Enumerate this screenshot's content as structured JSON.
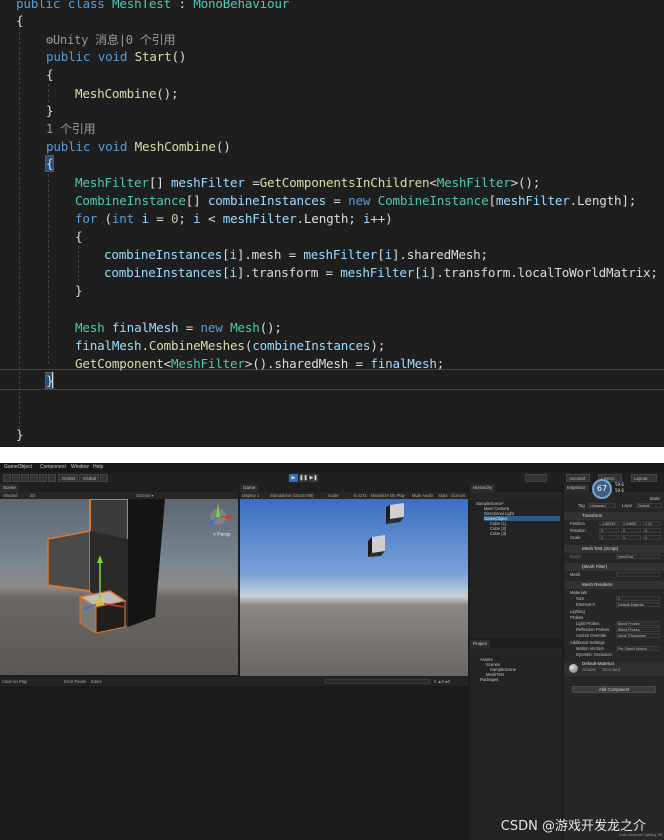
{
  "code_editor": {
    "lines": {
      "l0": {
        "kw1": "public",
        "kw2": "class",
        "name": "MeshTest",
        "colon": " : ",
        "base": "MonoBehaviour"
      },
      "l1": {
        "t": "{"
      },
      "l2": {
        "lens": "Unity 消息|0 个引用"
      },
      "l3": {
        "kw1": "public",
        "kw2": "void",
        "fn": "Start",
        "rest": "()"
      },
      "l4": {
        "t": "{"
      },
      "l5": {
        "fn": "MeshCombine",
        "rest": "();"
      },
      "l6": {
        "t": "}"
      },
      "l7": {
        "lens": "1 个引用"
      },
      "l8": {
        "kw1": "public",
        "kw2": "void",
        "fn": "MeshCombine",
        "rest": "()"
      },
      "l9": {
        "t": "{"
      },
      "l10": {
        "ty": "MeshFilter",
        "p1": "[] ",
        "va": "meshFilter",
        "p2": " =",
        "fn": "GetComponentsInChildren",
        "p3": "<",
        "ty2": "MeshFilter",
        "p4": ">();"
      },
      "l11": {
        "ty": "CombineInstance",
        "p1": "[] ",
        "va": "combineInstances",
        "p2": " = ",
        "kw": "new",
        "p3": " ",
        "ty2": "CombineInstance",
        "p4": "[",
        "va2": "meshFilter",
        "p5": ".Length];"
      },
      "l12": {
        "kw": "for",
        "p1": " (",
        "kw2": "int",
        "p2": " ",
        "va": "i",
        "p3": " = ",
        "nu": "0",
        "p4": "; ",
        "va2": "i",
        "p5": " < ",
        "va3": "meshFilter",
        "p6": ".Length; ",
        "va4": "i",
        "p7": "++)"
      },
      "l13": {
        "t": "{"
      },
      "l14": {
        "va": "combineInstances",
        "p1": "[",
        "va2": "i",
        "p2": "].mesh = ",
        "va3": "meshFilter",
        "p3": "[",
        "va4": "i",
        "p4": "].sharedMesh;"
      },
      "l15": {
        "va": "combineInstances",
        "p1": "[",
        "va2": "i",
        "p2": "].transform = ",
        "va3": "meshFilter",
        "p3": "[",
        "va4": "i",
        "p4": "].transform.localToWorldMatrix;"
      },
      "l16": {
        "t": "}"
      },
      "l17": {
        "ty": "Mesh",
        "p1": " ",
        "va": "finalMesh",
        "p2": " = ",
        "kw": "new",
        "p3": " ",
        "ty2": "Mesh",
        "p4": "();"
      },
      "l18": {
        "va": "finalMesh",
        "p1": ".",
        "fn": "CombineMeshes",
        "p2": "(",
        "va2": "combineInstances",
        "p3": ");"
      },
      "l19": {
        "fn": "GetComponent",
        "p1": "<",
        "ty": "MeshFilter",
        "p2": ">().sharedMesh = ",
        "va": "finalMesh",
        "p3": ";"
      },
      "l20": {
        "t": "}"
      },
      "l21": {
        "t": "}"
      }
    }
  },
  "unity": {
    "menu": [
      "GameObject",
      "Component",
      "Window",
      "Help"
    ],
    "toolbar": {
      "center": "Center",
      "global": "Global",
      "account": "Account",
      "layers": "Layers",
      "layout": "Layout"
    },
    "scene": {
      "tab": "Scene",
      "shading": "Shaded",
      "mode": "2D",
      "persp": "< Persp"
    },
    "game": {
      "tab": "Game",
      "display": "Display 1",
      "resolution": "Standalone (1024x768)",
      "scale": "Scale",
      "scale_value": "0.417x",
      "maximize": "Maximize On Play",
      "mute": "Mute Audio",
      "stats": "Stats",
      "gizmos": "Gizmos"
    },
    "hierarchy": {
      "tab": "Hierarchy",
      "items": [
        "SampleScene*",
        "Main Camera",
        "Directional Light",
        "GameObject",
        "Cube (1)",
        "Cube (2)",
        "Cube (3)"
      ]
    },
    "project": {
      "tab": "Project",
      "items": [
        "Assets",
        "Scenes",
        "SampleScene",
        "MeshTest",
        "Packages"
      ]
    },
    "console": {
      "tab": "Clear on Play",
      "error_pause": "Error Pause",
      "editor": "Editor",
      "clear": "Clear",
      "collapse": "Collapse"
    },
    "inspector": {
      "tab": "Inspector",
      "tag": "Tag",
      "tag_value": "Untagged",
      "layer": "Layer",
      "layer_value": "Default",
      "static": "Static",
      "transform": {
        "title": "Transform",
        "position": "Position",
        "rotation": "Rotation",
        "scale": "Scale",
        "pos": [
          "-1.88259",
          "1.44658",
          "7.12"
        ],
        "rot": [
          "0",
          "0",
          "0"
        ],
        "scl": [
          "1",
          "1",
          "1"
        ]
      },
      "script": {
        "title": "Mesh Test (Script)",
        "script_label": "Script",
        "script_value": "MeshTest"
      },
      "filter": {
        "title": "(Mesh Filter)",
        "mesh_label": "Mesh",
        "mesh_value": ""
      },
      "renderer": {
        "title": "Mesh Renderer",
        "materials": "Materials",
        "size": "Size",
        "size_value": "1",
        "element": "Element 0",
        "element_value": "Default-Material",
        "lighting": "Lighting",
        "probes": "Probes",
        "light_probes": "Light Probes",
        "light_probes_value": "Blend Probes",
        "reflection": "Reflection Probes",
        "reflection_value": "Blend Probes",
        "anchor": "Anchor Override",
        "anchor_value": "None (Transform)",
        "additional": "Additional Settings",
        "motion": "Motion Vectors",
        "motion_value": "Per Object Motion",
        "dynamic": "Dynamic Occlusion"
      },
      "material": {
        "name": "Default-Material",
        "shader": "Shader",
        "shader_value": "Standard"
      },
      "add_component": "Add Component"
    },
    "fps": {
      "value": "67",
      "rate1": "59.6",
      "rate2": "59.6"
    },
    "footer": "Auto Generate Lighting Off"
  },
  "watermark": "CSDN @游戏开发龙之介"
}
